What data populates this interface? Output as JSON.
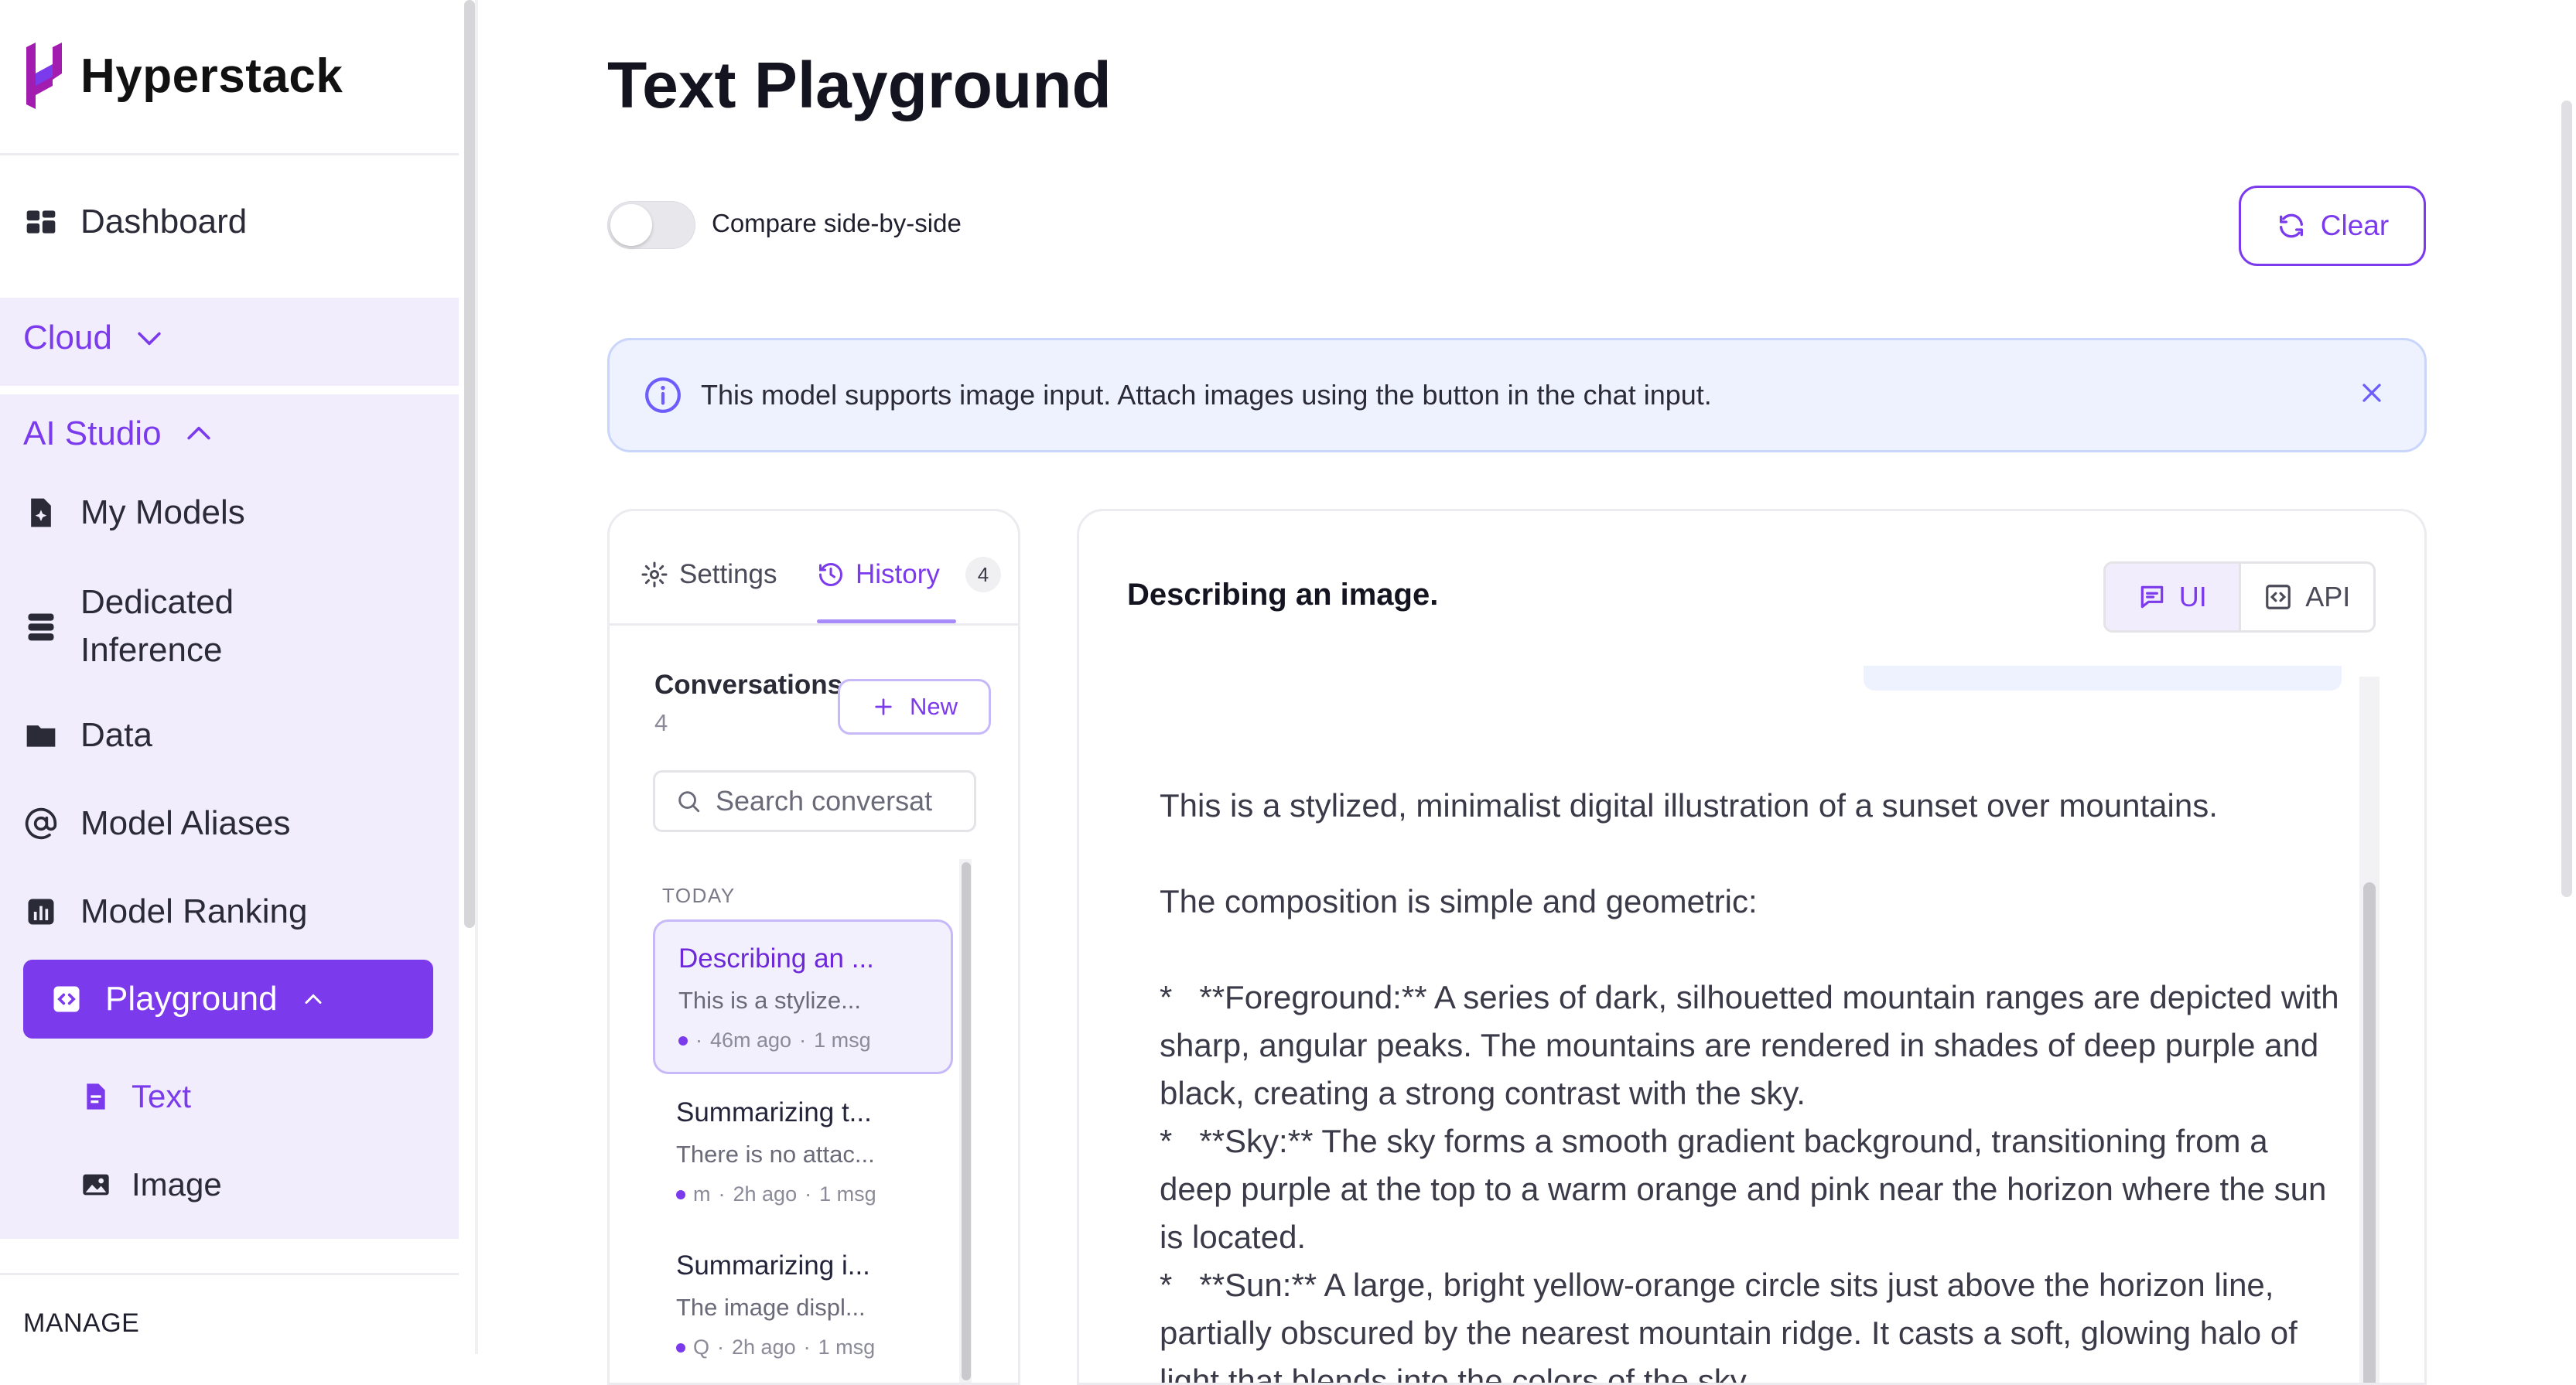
{
  "brand": {
    "name": "Hyperstack",
    "accent": "#7c3aed"
  },
  "sidebar": {
    "dashboard": "Dashboard",
    "cloud": "Cloud",
    "ai_studio": "AI Studio",
    "items": [
      {
        "label": "My Models",
        "icon": "file-sparkle-icon"
      },
      {
        "label": "Dedicated\nInference",
        "icon": "server-stack-icon"
      },
      {
        "label": "Data",
        "icon": "folder-icon"
      },
      {
        "label": "Model Aliases",
        "icon": "at-sign-icon"
      },
      {
        "label": "Model Ranking",
        "icon": "bar-chart-icon"
      }
    ],
    "playground": "Playground",
    "sub_items": [
      {
        "label": "Text",
        "icon": "document-icon"
      },
      {
        "label": "Image",
        "icon": "image-icon"
      }
    ],
    "manage": "MANAGE"
  },
  "main": {
    "title": "Text Playground",
    "compare_label": "Compare side-by-side",
    "compare_on": false,
    "clear_label": "Clear",
    "banner": "This model supports image input. Attach images using the button in the chat input."
  },
  "left_panel": {
    "tabs": {
      "settings": "Settings",
      "history": "History",
      "history_count": "4"
    },
    "conversations_label": "Conversations",
    "conversations_count": "4",
    "new_label": "New",
    "search_placeholder": "Search conversat",
    "group_today": "TODAY",
    "conversations": [
      {
        "title": "Describing an ...",
        "preview": "This is a stylize...",
        "model": "",
        "time": "46m ago",
        "msgs": "1 msg"
      },
      {
        "title": "Summarizing t...",
        "preview": "There is no attac...",
        "model": "m",
        "time": "2h ago",
        "msgs": "1 msg"
      },
      {
        "title": "Summarizing i...",
        "preview": "The image displ...",
        "model": "Q",
        "time": "2h ago",
        "msgs": "1 msg"
      }
    ]
  },
  "chat": {
    "title": "Describing an image.",
    "mode_ui": "UI",
    "mode_api": "API",
    "message": {
      "p1": "This is a stylized, minimalist digital illustration of a sunset over mountains.",
      "p2": "The composition is simple and geometric:",
      "p3": "*   **Foreground:** A series of dark, silhouetted mountain ranges are depicted with sharp, angular peaks. The mountains are rendered in shades of deep purple and black, creating a strong contrast with the sky.\n*   **Sky:** The sky forms a smooth gradient background, transitioning from a deep purple at the top to a warm orange and pink near the horizon where the sun is located.\n*   **Sun:** A large, bright yellow-orange circle sits just above the horizon line, partially obscured by the nearest mountain ridge. It casts a soft, glowing halo of light that blends into the colors of the sky."
    }
  }
}
